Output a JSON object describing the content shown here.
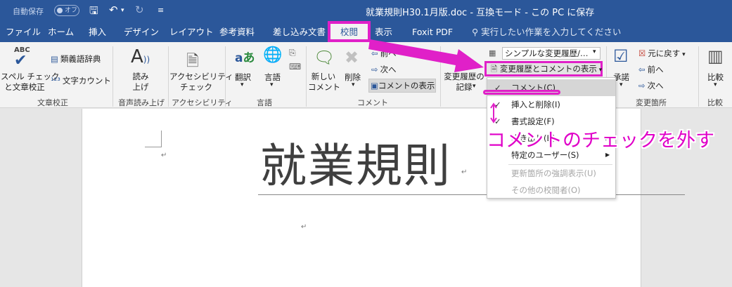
{
  "titlebar": {
    "autosave_label": "自動保存",
    "autosave_state": "オフ",
    "doc_title": "就業規則H30.1月版.doc  -  互換モード  -  この PC に保存"
  },
  "tabs": [
    "ファイル",
    "ホーム",
    "挿入",
    "デザイン",
    "レイアウト",
    "参考資料",
    "差し込み文書",
    "校閲",
    "表示",
    "Foxit PDF"
  ],
  "tell_me": "実行したい作業を入力してください",
  "ribbon": {
    "proofing": {
      "spell_label_1": "スペル チェック",
      "spell_label_2": "と文章校正",
      "thesaurus": "類義語辞典",
      "word_count": "文字カウント",
      "group": "文章校正"
    },
    "speech": {
      "read_1": "読み",
      "read_2": "上げ",
      "group": "音声読み上げ"
    },
    "accessibility": {
      "btn_1": "アクセシビリティ",
      "btn_2": "チェック",
      "group": "アクセシビリティ"
    },
    "language": {
      "translate": "翻訳",
      "language": "言語",
      "group": "言語"
    },
    "comments": {
      "new_1": "新しい",
      "new_2": "コメント",
      "delete": "削除",
      "prev": "前へ",
      "next": "次へ",
      "show_comments": "コメントの表示",
      "group": "コメント"
    },
    "tracking": {
      "track_1": "変更履歴の",
      "track_2": "記録",
      "simple_markup": "シンプルな変更履歴/…",
      "show_markup": "変更履歴とコメントの表示"
    },
    "changes": {
      "accept": "承諾",
      "reject": "元に戻す",
      "prev": "前へ",
      "next": "次へ",
      "group": "変更箇所"
    },
    "compare": {
      "compare": "比較",
      "group": "比較"
    }
  },
  "menu": {
    "items": [
      {
        "label": "コメント(C)",
        "checked": true
      },
      {
        "label": "挿入と削除(I)",
        "checked": true
      },
      {
        "label": "書式設定(F)",
        "checked": true
      },
      {
        "label": "吹き出し(B)",
        "checked": false
      },
      {
        "label": "特定のユーザー(S)",
        "checked": false
      },
      {
        "label": "更新箇所の強調表示(U)",
        "checked": false
      },
      {
        "label": "その他の校閲者(O)",
        "checked": false
      }
    ]
  },
  "document": {
    "heading": "就業規則"
  },
  "annotation": {
    "callout": "コメントのチェックを外す",
    "color": "#e020c8"
  }
}
